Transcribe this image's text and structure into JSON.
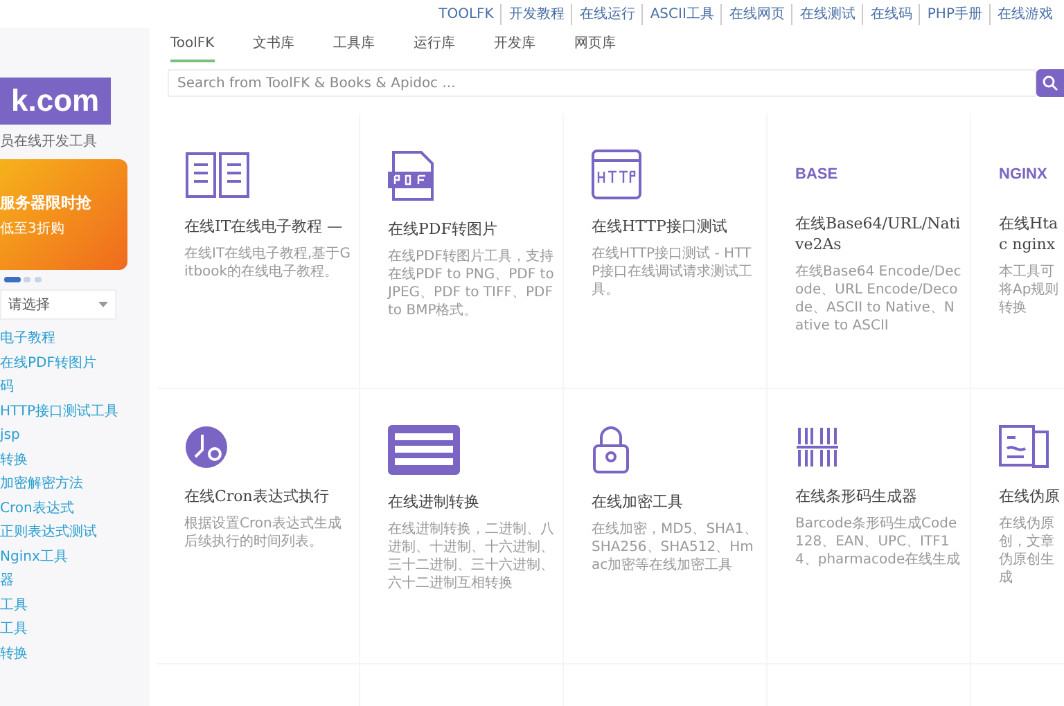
{
  "top_links": [
    "TOOLFK",
    "开发教程",
    "在线运行",
    "ASCII工具",
    "在线网页",
    "在线测试",
    "在线码",
    "PHP手册",
    "在线游戏"
  ],
  "tabs": [
    {
      "label": "ToolFK",
      "selected": true
    },
    {
      "label": "文书库",
      "selected": false
    },
    {
      "label": "工具库",
      "selected": false
    },
    {
      "label": "运行库",
      "selected": false
    },
    {
      "label": "开发库",
      "selected": false
    },
    {
      "label": "网页库",
      "selected": false
    }
  ],
  "search": {
    "placeholder": "Search from ToolFK & Books & Apidoc ..."
  },
  "sidebar": {
    "logo": "k.com",
    "tagline": "员在线开发工具",
    "banner": {
      "headline": "服务器限时抢",
      "subline": "低至3折购"
    },
    "carousel_dots": [
      {
        "selected": true
      },
      {
        "selected": false
      },
      {
        "selected": false
      }
    ],
    "select": {
      "value": "请选择"
    },
    "items": [
      "电子教程",
      "在线PDF转图片",
      "码",
      "HTTP接口测试工具",
      "jsp",
      "转换",
      "加密解密方法",
      "Cron表达式",
      "正则表达式测试",
      "Nginx工具",
      "器",
      "工具",
      "工具",
      "转换"
    ]
  },
  "cards": [
    {
      "title": "在线IT在线电子教程 —",
      "description": "在线IT在线电子教程,基于Gitbook的在线电子教程。"
    },
    {
      "title": "在线PDF转图片",
      "description": "在线PDF转图片工具，支持在线PDF to PNG、PDF to JPEG、PDF to TIFF、PDF to BMP格式。"
    },
    {
      "title": "在线HTTP接口测试",
      "description": "在线HTTP接口测试 - HTTP接口在线调试请求测试工具。"
    },
    {
      "title": "在线Base64/URL/Native2As",
      "description": "在线Base64 Encode/Decode、URL Encode/Decode、ASCII to Native、Native to ASCII",
      "icon_text": "BASE"
    },
    {
      "title": "在线Htac nginx",
      "description": "本工具可将Ap规则转换",
      "icon_text": "NGINX"
    },
    {
      "title": "在线Cron表达式执行",
      "description": "根据设置Cron表达式生成后续执行的时间列表。"
    },
    {
      "title": "在线进制转换",
      "description": "在线进制转换，二进制、八进制、十进制、十六进制、三十二进制、三十六进制、六十二进制互相转换"
    },
    {
      "title": "在线加密工具",
      "description": "在线加密，MD5、SHA1、SHA256、SHA512、Hmac加密等在线加密工具"
    },
    {
      "title": "在线条形码生成器",
      "description": "Barcode条形码生成Code128、EAN、UPC、ITF14、pharmacode在线生成"
    },
    {
      "title": "在线伪原",
      "description": "在线伪原创，文章伪原创生成"
    }
  ]
}
